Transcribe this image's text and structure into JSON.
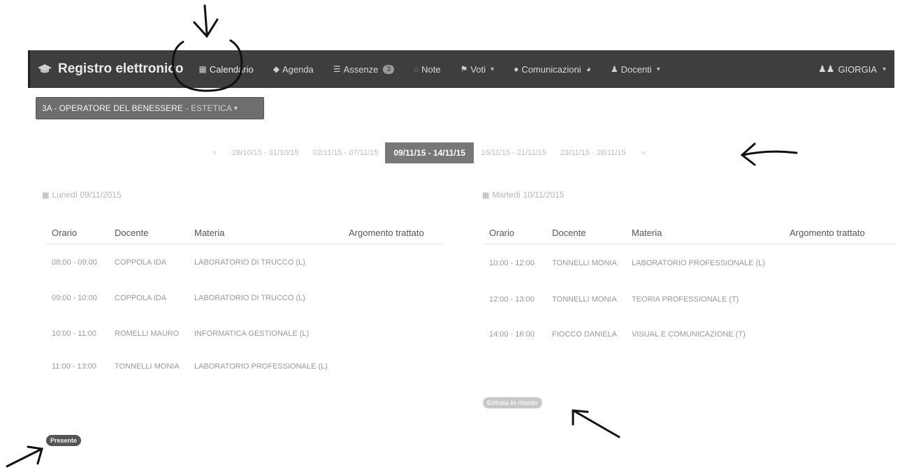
{
  "navbar": {
    "brand": "Registro elettronico",
    "items": [
      {
        "label": "Calendario",
        "icon": "calendar-icon",
        "active": true
      },
      {
        "label": "Agenda",
        "icon": "tag-icon"
      },
      {
        "label": "Assenze",
        "icon": "list-icon",
        "badge": "3"
      },
      {
        "label": "Note",
        "icon": "comment-icon"
      },
      {
        "label": "Voti",
        "icon": "flag-icon",
        "dropdown": true
      },
      {
        "label": "Comunicazioni",
        "icon": "speech-bubble-icon"
      },
      {
        "label": "Docenti",
        "icon": "users-icon",
        "dropdown": true
      }
    ],
    "user": "GIORGIA"
  },
  "class_selector": {
    "main": "3A - OPERATORE DEL BENESSERE",
    "sub": "- ESTETICA"
  },
  "weeks": {
    "prev": "«",
    "next": "»",
    "items": [
      {
        "label": "26/10/15 - 31/10/15"
      },
      {
        "label": "02/11/15 - 07/11/15"
      },
      {
        "label": "09/11/15 - 14/11/15",
        "current": true
      },
      {
        "label": "16/11/15 - 21/11/15"
      },
      {
        "label": "23/11/15 - 28/11/15"
      }
    ]
  },
  "columns": [
    "Orario",
    "Docente",
    "Materia",
    "Argomento trattato"
  ],
  "days": [
    {
      "title": "Lunedì 09/11/2015",
      "rows": [
        {
          "time": "08:00 - 09:00",
          "teacher": "COPPOLA IDA",
          "subject": "LABORATORIO DI TRUCCO (L)",
          "topic": ""
        },
        {
          "time": "09:00 - 10:00",
          "teacher": "COPPOLA IDA",
          "subject": "LABORATORIO DI TRUCCO (L)",
          "topic": ""
        },
        {
          "time": "10:00 - 11:00",
          "teacher": "ROMELLI MAURO",
          "subject": "INFORMATICA GESTIONALE (L)",
          "topic": ""
        },
        {
          "time": "11:00 - 13:00",
          "teacher": "TONNELLI MONIA",
          "subject": "LABORATORIO PROFESSIONALE (L)",
          "topic": ""
        }
      ],
      "status": "Presente"
    },
    {
      "title": "Martedì 10/11/2015",
      "rows": [
        {
          "time": "10:00 - 12:00",
          "teacher": "TONNELLI MONIA",
          "subject": "LABORATORIO PROFESSIONALE (L)",
          "topic": ""
        },
        {
          "time": "12:00 - 13:00",
          "teacher": "TONNELLI MONIA",
          "subject": "TEORIA PROFESSIONALE (T)",
          "topic": ""
        },
        {
          "time": "14:00 - 16:00",
          "teacher": "FIOCCO DANIELA",
          "subject": "VISUAL E COMUNICAZIONE (T)",
          "topic": ""
        }
      ],
      "status": "Entrata in ritardo"
    }
  ]
}
